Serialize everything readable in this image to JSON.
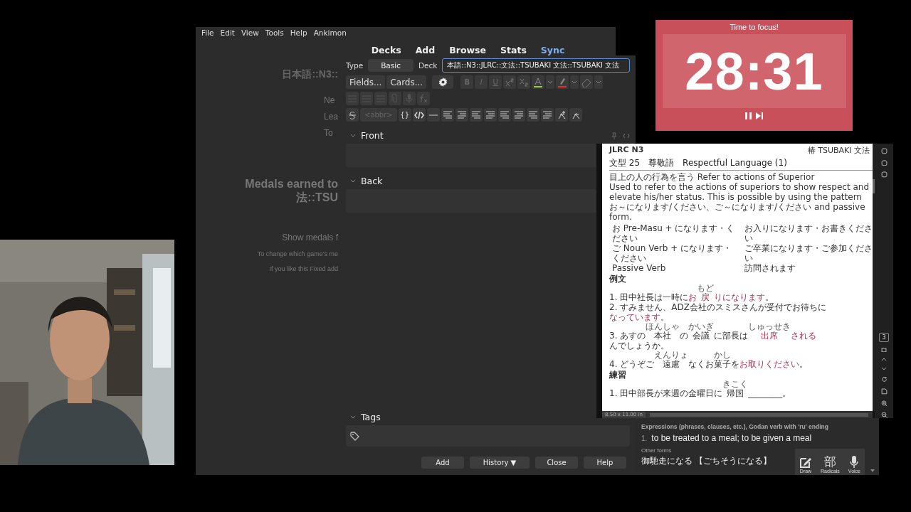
{
  "main_window": {
    "menu": [
      "File",
      "Edit",
      "View",
      "Tools",
      "Help",
      "Ankimon"
    ],
    "toolbar": [
      {
        "label": "Decks",
        "highlighted": false
      },
      {
        "label": "Add",
        "highlighted": false
      },
      {
        "label": "Browse",
        "highlighted": false
      },
      {
        "label": "Stats",
        "highlighted": false
      },
      {
        "label": "Sync",
        "highlighted": true
      }
    ],
    "deck_title": "日本語::N3::",
    "stats": [
      "Ne",
      "Lea",
      "To"
    ],
    "medals_heading": [
      "Medals earned to",
      "法::TSU"
    ],
    "medals_link": "Show medals f",
    "notes": [
      "To change which game's me",
      "If you like this Fixed add"
    ]
  },
  "add_window": {
    "type_label": "Type",
    "note_type": "Basic",
    "deck_label": "Deck",
    "deck": "本語::N3::JLRC::文法::TSUBAKI 文法::TSUBAKI 文法",
    "top_buttons": [
      "Fields...",
      "Cards..."
    ],
    "format_buttons": [
      {
        "label": "B",
        "disabled": true
      },
      {
        "label": "I",
        "disabled": true
      },
      {
        "label": "U",
        "disabled": true
      }
    ],
    "abbr": {
      "label": "<abbr>",
      "disabled": true
    },
    "braces": "{}",
    "fields": [
      {
        "name": "Front",
        "expanded": true
      },
      {
        "name": "Back",
        "expanded": true
      }
    ],
    "tags": {
      "label": "Tags",
      "expanded": true
    },
    "actions": [
      "Add",
      "History ▼",
      "Close",
      "Help"
    ]
  },
  "pdf_viewer": {
    "header_left": "JLRC N3",
    "header_right": "椿 TSUBAKI 文法",
    "title": "文型 25　尊敬語　Respectful Language (1)",
    "subtitle": "目上の人の行為を言う Refer to actions of Superior",
    "paragraph": "Used to refer to the actions of superiors to show respect and elevate his/her status. This is possible by using the pattern お～になります/ください、ご～になります/ください and passive form.",
    "patterns": [
      [
        "お Pre-Masu + になります・ください",
        "お入りになります・お書きください"
      ],
      [
        "ご Noun Verb + になります・ください",
        "ご卒業になります・ご参加ください"
      ],
      [
        "Passive Verb",
        "訪問されます"
      ]
    ],
    "examples_heading": "例文",
    "examples": [
      [
        {
          "t": "1. 田中社長は一時に"
        },
        {
          "t": "お",
          "red": true
        },
        {
          "t": "戻",
          "ruby": "もど",
          "red": true
        },
        {
          "t": "りになります",
          "red": true
        },
        {
          "t": "。"
        }
      ],
      [
        {
          "t": "2. すみません、ADZ会社のスミスさんが受付でお待ちに"
        },
        {
          "t": "なっています",
          "red": true
        },
        {
          "t": "。"
        }
      ],
      [
        {
          "t": "3. あすの"
        },
        {
          "t": "本社",
          "ruby": "ほんしゃ"
        },
        {
          "t": "の"
        },
        {
          "t": "会議",
          "ruby": "かいぎ"
        },
        {
          "t": "に部長は"
        },
        {
          "t": "出席",
          "ruby": "しゅっせき",
          "red": true
        },
        {
          "t": "される",
          "red": true
        },
        {
          "t": "んでしょうか。"
        }
      ],
      [
        {
          "t": "4. どうぞご"
        },
        {
          "t": "遠慮",
          "ruby": "えんりょ"
        },
        {
          "t": "なくお"
        },
        {
          "t": "菓子",
          "ruby": "かし"
        },
        {
          "t": "を"
        },
        {
          "t": "お取りください",
          "red": true
        },
        {
          "t": "。"
        }
      ]
    ],
    "practice_heading": "練習",
    "practice": [
      {
        "t": "1. 田中部長が来週の金曜日に"
      },
      {
        "t": "帰国",
        "ruby": "きこく"
      },
      {
        "t": "________。"
      }
    ],
    "page_number": "3",
    "page_size": "8.50 x 11.00 in"
  },
  "timer": {
    "title": "Time to focus!",
    "time": "28:31"
  },
  "dictionary": {
    "part_of_speech": "Expressions (phrases, clauses, etc.), Godan verb with 'ru' ending",
    "sense_number": "1.",
    "sense": "to be treated to a meal; to be given a meal",
    "other_forms_label": "Other forms",
    "other_forms": "御馳走になる 【ごちそうになる】",
    "tools": [
      {
        "kind": "draw",
        "label": "Draw"
      },
      {
        "kind": "radicals",
        "glyph": "部",
        "label": "Radicals"
      },
      {
        "kind": "voice",
        "label": "Voice"
      }
    ]
  }
}
